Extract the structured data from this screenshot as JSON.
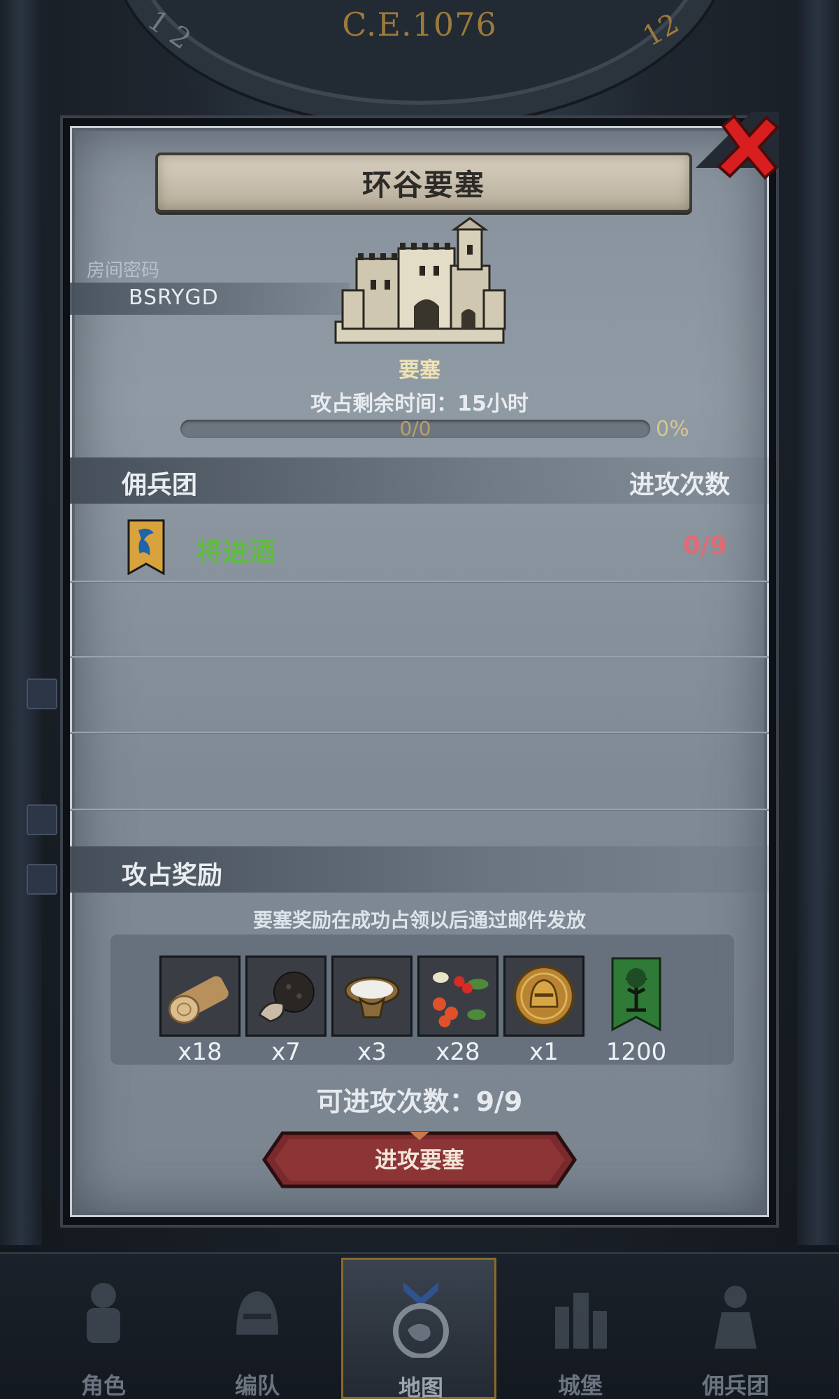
{
  "background": {
    "year": "C.E.1076",
    "dial_left_digits": "1 2",
    "dial_right_digits": "12"
  },
  "modal": {
    "title": "环谷要塞",
    "room": {
      "label": "房间密码",
      "code": "BSRYGD"
    },
    "fortress": {
      "label": "要塞",
      "time_remaining": "攻占剩余时间：15小时",
      "progress_count": "0/0",
      "progress_percent": "0%",
      "progress_value": 0
    },
    "mercenary_section": {
      "header_left": "佣兵团",
      "header_right": "进攻次数",
      "rows": [
        {
          "name": "将进酒",
          "attempts": "0/9"
        }
      ]
    },
    "rewards": {
      "header": "攻占奖励",
      "note": "要塞奖励在成功占领以后通过邮件发放",
      "items": [
        {
          "icon": "log-icon",
          "qty": "x18"
        },
        {
          "icon": "truffle-icon",
          "qty": "x7"
        },
        {
          "icon": "bowl-icon",
          "qty": "x3"
        },
        {
          "icon": "berries-icon",
          "qty": "x28"
        },
        {
          "icon": "helmet-coin-icon",
          "qty": "x1"
        },
        {
          "icon": "guild-banner-icon",
          "qty": "1200"
        }
      ]
    },
    "attacks_left": "可进攻次数：9/9",
    "attack_button": "进攻要塞"
  },
  "nav": {
    "items": [
      {
        "label": "角色",
        "icon": "knight-icon"
      },
      {
        "label": "编队",
        "icon": "helmet-icon"
      },
      {
        "label": "地图",
        "icon": "map-icon",
        "active": true
      },
      {
        "label": "城堡",
        "icon": "castle-icon"
      },
      {
        "label": "佣兵团",
        "icon": "mercenary-icon"
      }
    ]
  },
  "colors": {
    "accent_gold": "#c09a4a",
    "merc_name": "#5fbd3c",
    "attempts_red": "#e06b74",
    "close_red": "#d81e1e",
    "button_red": "#7a2a2c"
  }
}
